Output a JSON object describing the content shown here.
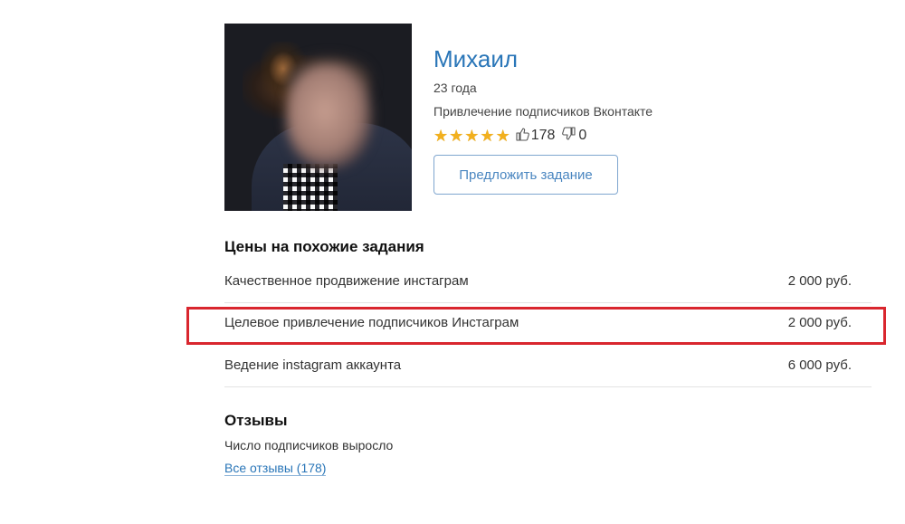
{
  "profile": {
    "name": "Михаил",
    "age": "23 года",
    "specialty": "Привлечение подписчиков Вконтакте",
    "rating_stars": 5,
    "likes": "178",
    "dislikes": "0",
    "offer_button_label": "Предложить задание"
  },
  "prices": {
    "title": "Цены на похожие задания",
    "rows": [
      {
        "task": "Качественное продвижение инстаграм",
        "price": "2 000 руб."
      },
      {
        "task": "Целевое привлечение подписчиков Инстаграм",
        "price": "2 000 руб."
      },
      {
        "task": "Ведение instagram аккаунта",
        "price": "6 000 руб."
      }
    ]
  },
  "reviews": {
    "title": "Отзывы",
    "text": "Число подписчиков выросло",
    "all_reviews_link": "Все отзывы (178)"
  },
  "colors": {
    "accent": "#2a76b8",
    "star": "#f2b01e",
    "highlight": "#d9262e"
  },
  "icons": {
    "like": "thumbs-up-icon",
    "dislike": "thumbs-down-icon",
    "star": "star-icon"
  }
}
